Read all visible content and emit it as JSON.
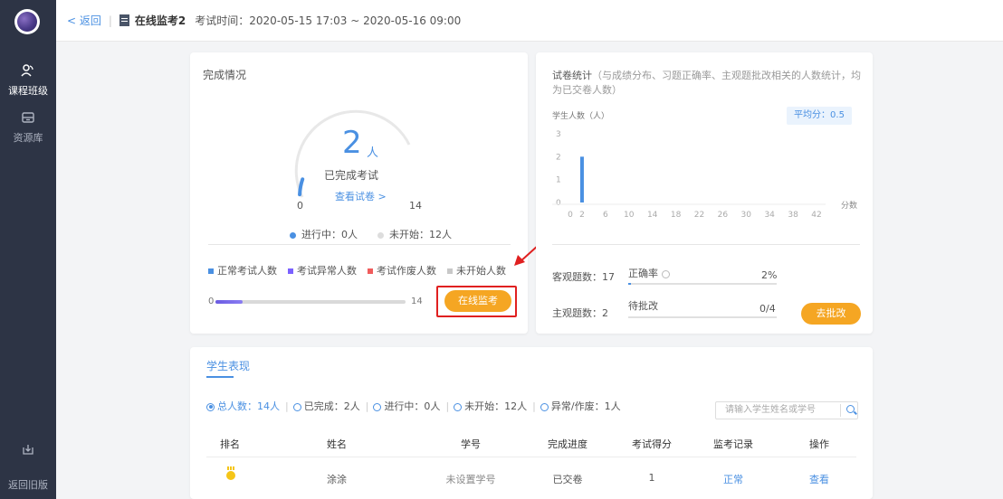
{
  "sidebar": {
    "items": [
      {
        "label": "课程班级",
        "icon": "class-icon",
        "active": true
      },
      {
        "label": "资源库",
        "icon": "library-icon",
        "active": false
      }
    ],
    "bottom_label": "返回旧版"
  },
  "topbar": {
    "back": "< 返回",
    "title": "在线监考2",
    "time": "考试时间：2020-05-15 17:03 ~ 2020-05-16 09:00"
  },
  "completion": {
    "title": "完成情况",
    "count": "2",
    "unit": "人",
    "label": "已完成考试",
    "link": "查看试卷 >",
    "min": "0",
    "max": "14",
    "completed_fraction": 0.143,
    "in_progress": "进行中：0人",
    "not_started": "未开始：12人",
    "legend": [
      "正常考试人数",
      "考试异常人数",
      "考试作废人数",
      "未开始人数"
    ],
    "legend_colors": [
      "#4a90e2",
      "#7b61ff",
      "#f05c5c",
      "#c8c8c8"
    ],
    "bar_min": "0",
    "bar_max": "14",
    "bar_fill_fraction": 0.143,
    "monitor_button": "在线监考"
  },
  "stats": {
    "title": "试卷统计",
    "subtitle": "（与成绩分布、习题正确率、主观题批改相关的人数统计，均为已交卷人数）",
    "ylabel": "学生人数（人）",
    "avg": "平均分：0.5",
    "objective_label": "客观题数：17",
    "subjective_label": "主观题数：2",
    "accuracy_label": "正确率",
    "accuracy_value": "2%",
    "accuracy_fraction": 0.02,
    "pending_label": "待批改",
    "pending_value": "0/4",
    "pending_fraction": 0,
    "grade_button": "去批改"
  },
  "chart_data": {
    "type": "bar",
    "xlabel": "分数",
    "ylabel": "学生人数（人）",
    "y_ticks": [
      0,
      1,
      2,
      3
    ],
    "x_ticks": [
      0,
      2,
      6,
      10,
      14,
      18,
      22,
      26,
      30,
      34,
      38,
      42
    ],
    "ylim": [
      0,
      3
    ],
    "categories": [
      "2"
    ],
    "values": [
      2
    ]
  },
  "students": {
    "tab": "学生表现",
    "filters": [
      {
        "label": "总人数：14人",
        "checked": true
      },
      {
        "label": "已完成：2人",
        "checked": false
      },
      {
        "label": "进行中：0人",
        "checked": false
      },
      {
        "label": "未开始：12人",
        "checked": false
      },
      {
        "label": "异常/作废：1人",
        "checked": false
      }
    ],
    "search_placeholder": "请输入学生姓名或学号",
    "columns": [
      "排名",
      "姓名",
      "学号",
      "完成进度",
      "考试得分",
      "监考记录",
      "操作"
    ],
    "rows": [
      {
        "name": "涂涂",
        "id": "未设置学号",
        "progress": "已交卷",
        "score": "1",
        "record": "正常",
        "action": "查看"
      }
    ]
  }
}
